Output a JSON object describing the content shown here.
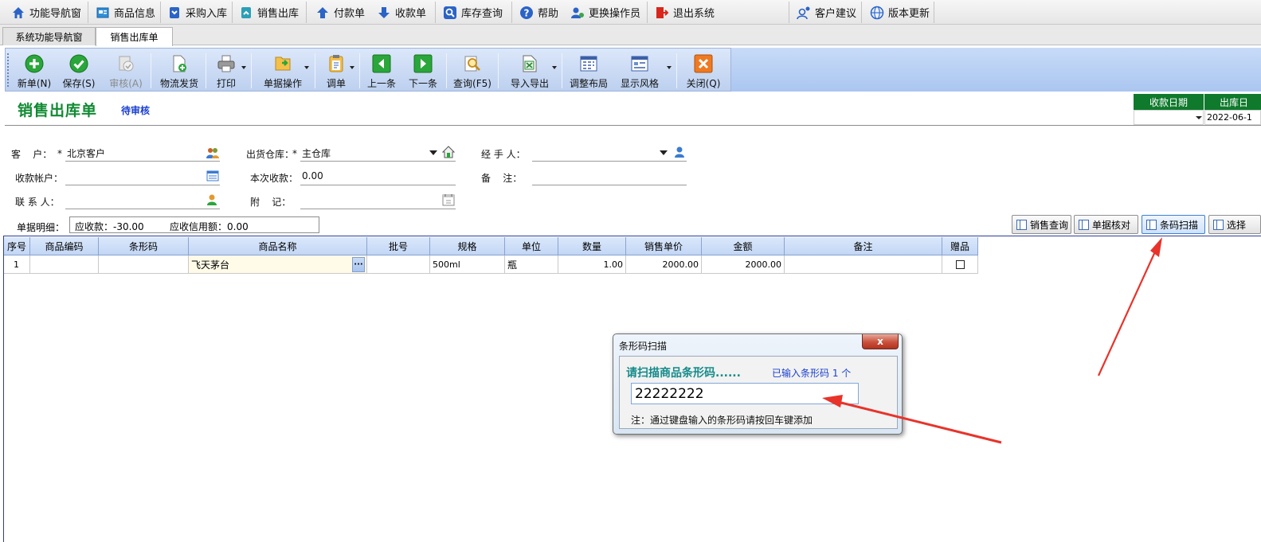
{
  "top_menu": [
    {
      "label": "功能导航窗",
      "icon": "home-icon"
    },
    {
      "label": "商品信息",
      "icon": "product-info-icon"
    },
    {
      "label": "采购入库",
      "icon": "purchase-in-icon"
    },
    {
      "label": "销售出库",
      "icon": "sales-out-icon"
    },
    {
      "label": "付款单",
      "icon": "payment-icon"
    },
    {
      "label": "收款单",
      "icon": "receipt-icon"
    },
    {
      "label": "库存查询",
      "icon": "inventory-search-icon"
    },
    {
      "label": "帮助",
      "icon": "help-icon"
    },
    {
      "label": "更换操作员",
      "icon": "switch-user-icon"
    },
    {
      "label": "退出系统",
      "icon": "exit-icon"
    },
    {
      "label": "客户建议",
      "icon": "feedback-icon"
    },
    {
      "label": "版本更新",
      "icon": "update-icon"
    }
  ],
  "tabs": [
    {
      "label": "系统功能导航窗",
      "active": false
    },
    {
      "label": "销售出库单",
      "active": true
    }
  ],
  "toolbar": [
    {
      "label": "新单(N)",
      "icon": "new-icon"
    },
    {
      "label": "保存(S)",
      "icon": "save-icon"
    },
    {
      "label": "审核(A)",
      "icon": "audit-icon",
      "disabled": true
    },
    {
      "label": "物流发货",
      "icon": "shipping-icon"
    },
    {
      "label": "打印",
      "icon": "print-icon"
    },
    {
      "label": "单据操作",
      "icon": "document-ops-icon"
    },
    {
      "label": "调单",
      "icon": "load-document-icon"
    },
    {
      "label": "上一条",
      "icon": "previous-icon"
    },
    {
      "label": "下一条",
      "icon": "next-icon"
    },
    {
      "label": "查询(F5)",
      "icon": "query-icon"
    },
    {
      "label": "导入导出",
      "icon": "import-export-icon"
    },
    {
      "label": "调整布局",
      "icon": "layout-icon"
    },
    {
      "label": "显示风格",
      "icon": "display-style-icon"
    },
    {
      "label": "关闭(Q)",
      "icon": "close-icon"
    }
  ],
  "form": {
    "title": "销售出库单",
    "status": "待审核",
    "date_headers": [
      "收款日期",
      "出库日"
    ],
    "date_values": [
      "",
      "2022-06-1"
    ],
    "fields": {
      "customer_label": "客    户：",
      "customer_value": "北京客户",
      "warehouse_label": "出货仓库：",
      "warehouse_value": "主仓库",
      "handler_label": "经 手 人：",
      "handler_value": "",
      "account_label": "收款帐户：",
      "account_value": "",
      "payment_label": "本次收款：",
      "payment_value": "0.00",
      "remark_label": "备    注：",
      "remark_value": "",
      "contact_label": "联 系 人：",
      "contact_value": "",
      "note_label": "附    记：",
      "note_value": "",
      "required_mark": "*"
    },
    "detail_label": "单据明细：",
    "receivable": "应收款：-30.00",
    "credit": "应收信用额：0.00"
  },
  "side_buttons": [
    "销售查询",
    "单据核对",
    "条码扫描",
    "选择"
  ],
  "grid": {
    "headers": [
      "序号",
      "商品编码",
      "条形码",
      "商品名称",
      "批号",
      "规格",
      "单位",
      "数量",
      "销售单价",
      "金额",
      "备注",
      "赠品"
    ],
    "rows": [
      {
        "no": "1",
        "code": "",
        "barcode": "",
        "name": "飞天茅台",
        "batch": "",
        "spec": "500ml",
        "unit": "瓶",
        "qty": "1.00",
        "price": "2000.00",
        "amount": "2000.00",
        "remark": "",
        "gift": false
      }
    ]
  },
  "dialog": {
    "title": "条形码扫描",
    "close": "x",
    "prompt": "请扫描商品条形码......",
    "count": "已输入条形码 1 个",
    "input_value": "22222222",
    "note": "注：通过键盘输入的条形码请按回车键添加"
  },
  "colors": {
    "title_green": "#108a33",
    "status_blue": "#1a3fd0",
    "date_header_green": "#0f7a2c",
    "annotation_red": "#e8332a"
  }
}
